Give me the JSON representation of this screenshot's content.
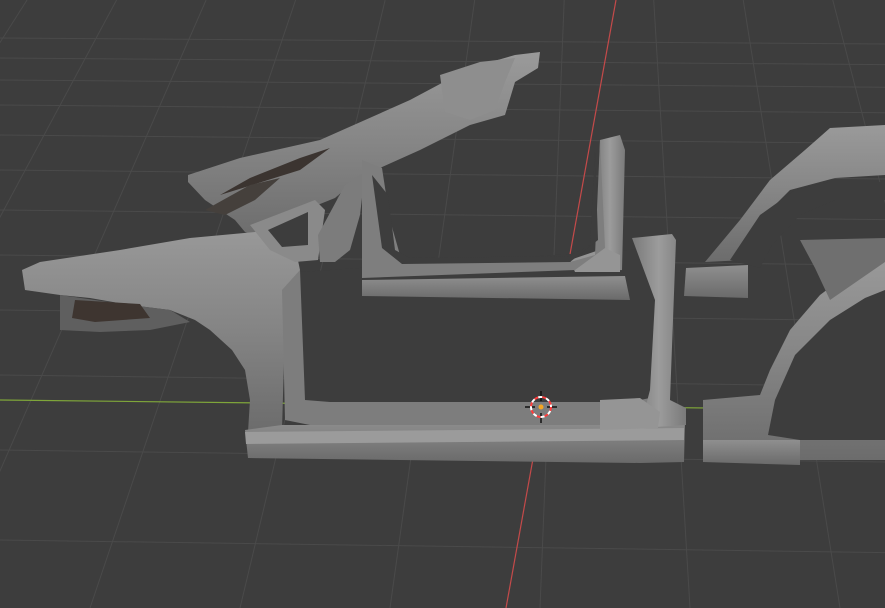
{
  "viewport": {
    "background_color": "#3d3d3d",
    "grid_color": "#4a4a4a",
    "x_axis_color": "#7fa63a",
    "y_axis_color": "#c44a4a",
    "mesh_color": "#8a8a8a",
    "mesh_highlight_color": "#a6a6a6",
    "mesh_shadow_color": "#5e5e5e",
    "cursor_ring_colors": [
      "#ff3b3b",
      "#ffffff"
    ],
    "origin_dot_color": "#f5a623"
  },
  "objects": [
    {
      "icon": "rear-quarter-panel-mesh"
    },
    {
      "icon": "front-rocker-panel-mesh"
    },
    {
      "icon": "rear-rocker-panel-mesh"
    },
    {
      "icon": "front-fender-mesh"
    }
  ],
  "cursor": {
    "icon": "3d-cursor-icon"
  }
}
